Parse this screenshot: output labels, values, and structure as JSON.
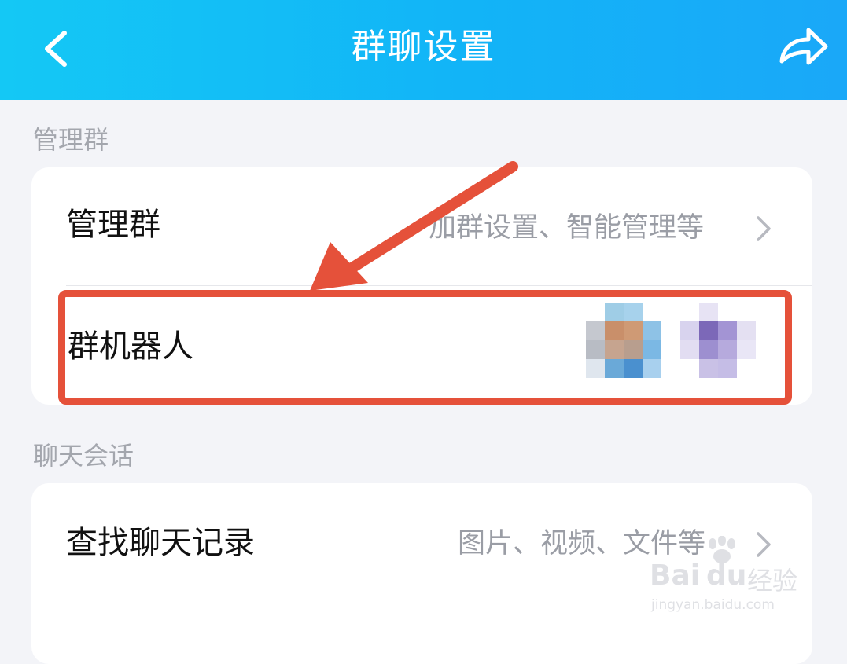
{
  "header": {
    "title": "群聊设置",
    "back_icon": "chevron-left-icon",
    "share_icon": "share-arrow-icon"
  },
  "sections": [
    {
      "label": "管理群",
      "rows": [
        {
          "label": "管理群",
          "subtitle": "加群设置、智能管理等"
        },
        {
          "label": "群机器人",
          "subtitle": ""
        }
      ]
    },
    {
      "label": "聊天会话",
      "rows": [
        {
          "label": "查找聊天记录",
          "subtitle": "图片、视频、文件等"
        }
      ]
    }
  ],
  "annotation": {
    "color": "#e5513a"
  },
  "watermark": {
    "brand": "Bai",
    "brand2": "du",
    "cn": "经验",
    "url": "jingyan.baidu.com"
  },
  "colors": {
    "header": "#12b4f7",
    "background": "#f3f4f8",
    "card": "#ffffff"
  }
}
